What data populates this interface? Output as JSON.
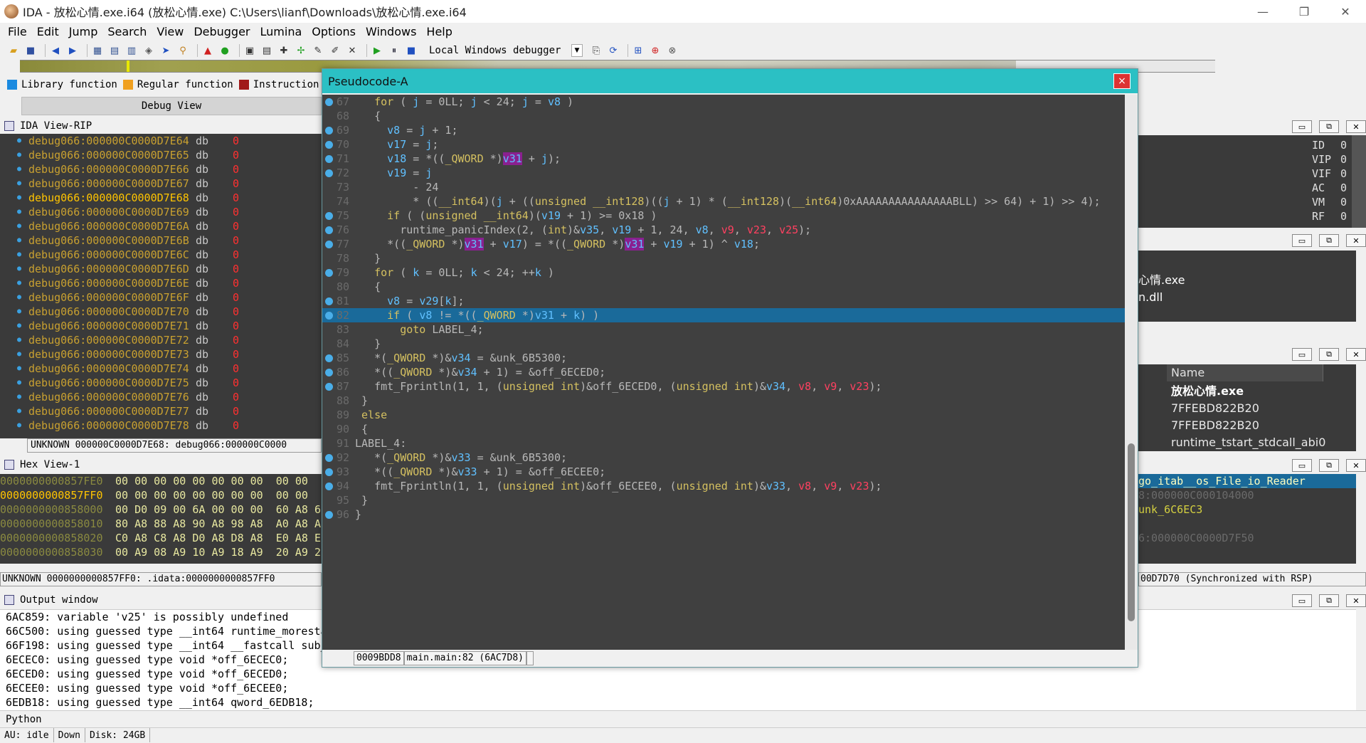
{
  "window": {
    "title": "IDA - 放松心情.exe.i64 (放松心情.exe) C:\\Users\\lianf\\Downloads\\放松心情.exe.i64",
    "min": "—",
    "max": "❐",
    "close": "✕"
  },
  "menu": [
    "File",
    "Edit",
    "Jump",
    "Search",
    "View",
    "Debugger",
    "Lumina",
    "Options",
    "Windows",
    "Help"
  ],
  "toolbar": {
    "debugger": "Local Windows debugger"
  },
  "legend": [
    {
      "label": "Library function",
      "color": "#1a8ae0"
    },
    {
      "label": "Regular function",
      "color": "#f0a020"
    },
    {
      "label": "Instruction",
      "color": "#a01818"
    }
  ],
  "debug_view_tab": "Debug View",
  "ida_view": {
    "title": "IDA View-RIP",
    "rows": [
      {
        "addr": "debug066:000000C0000D7E64",
        "op": "db",
        "val": "0"
      },
      {
        "addr": "debug066:000000C0000D7E65",
        "op": "db",
        "val": "0"
      },
      {
        "addr": "debug066:000000C0000D7E66",
        "op": "db",
        "val": "0"
      },
      {
        "addr": "debug066:000000C0000D7E67",
        "op": "db",
        "val": "0"
      },
      {
        "addr": "debug066:000000C0000D7E68",
        "op": "db",
        "val": "0"
      },
      {
        "addr": "debug066:000000C0000D7E69",
        "op": "db",
        "val": "0"
      },
      {
        "addr": "debug066:000000C0000D7E6A",
        "op": "db",
        "val": "0"
      },
      {
        "addr": "debug066:000000C0000D7E6B",
        "op": "db",
        "val": "0"
      },
      {
        "addr": "debug066:000000C0000D7E6C",
        "op": "db",
        "val": "0"
      },
      {
        "addr": "debug066:000000C0000D7E6D",
        "op": "db",
        "val": "0"
      },
      {
        "addr": "debug066:000000C0000D7E6E",
        "op": "db",
        "val": "0"
      },
      {
        "addr": "debug066:000000C0000D7E6F",
        "op": "db",
        "val": "0"
      },
      {
        "addr": "debug066:000000C0000D7E70",
        "op": "db",
        "val": "0"
      },
      {
        "addr": "debug066:000000C0000D7E71",
        "op": "db",
        "val": "0"
      },
      {
        "addr": "debug066:000000C0000D7E72",
        "op": "db",
        "val": "0"
      },
      {
        "addr": "debug066:000000C0000D7E73",
        "op": "db",
        "val": "0"
      },
      {
        "addr": "debug066:000000C0000D7E74",
        "op": "db",
        "val": "0"
      },
      {
        "addr": "debug066:000000C0000D7E75",
        "op": "db",
        "val": "0"
      },
      {
        "addr": "debug066:000000C0000D7E76",
        "op": "db",
        "val": "0"
      },
      {
        "addr": "debug066:000000C0000D7E77",
        "op": "db",
        "val": "0"
      },
      {
        "addr": "debug066:000000C0000D7E78",
        "op": "db",
        "val": "0"
      }
    ],
    "status": "UNKNOWN 000000C0000D7E68: debug066:000000C0000"
  },
  "hex_view": {
    "title": "Hex View-1",
    "rows": [
      {
        "addr": "0000000000857FE0",
        "bytes": "00 00 00 00 00 00 00 00  00 00"
      },
      {
        "addr": "0000000000857FF0",
        "bytes": "00 00 00 00 00 00 00 00  00 00"
      },
      {
        "addr": "0000000000858000",
        "bytes": "00 D0 09 00 6A 00 00 00  60 A8 6"
      },
      {
        "addr": "0000000000858010",
        "bytes": "80 A8 88 A8 90 A8 98 A8  A0 A8 A"
      },
      {
        "addr": "0000000000858020",
        "bytes": "C0 A8 C8 A8 D0 A8 D8 A8  E0 A8 E"
      },
      {
        "addr": "0000000000858030",
        "bytes": "00 A9 08 A9 10 A9 18 A9  20 A9 2"
      }
    ],
    "status": "UNKNOWN 0000000000857FF0: .idata:0000000000857FF0"
  },
  "output": {
    "title": "Output window",
    "lines": [
      "6AC859: variable 'v25' is possibly undefined",
      "66C500: using guessed type __int64 runtime_moresta",
      "66F198: using guessed type __int64 __fastcall sub_",
      "6ECEC0: using guessed type void *off_6ECEC0;",
      "6ECED0: using guessed type void *off_6ECED0;",
      "6ECEE0: using guessed type void *off_6ECEE0;",
      "6EDB18: using guessed type __int64 qword_6EDB18;"
    ],
    "python": "Python"
  },
  "statusbar": {
    "au": "AU:  idle",
    "dir": "Down",
    "disk": "Disk: 24GB"
  },
  "registers": [
    {
      "name": "ID",
      "val": "0"
    },
    {
      "name": "VIP",
      "val": "0"
    },
    {
      "name": "VIF",
      "val": "0"
    },
    {
      "name": "AC",
      "val": "0"
    },
    {
      "name": "VM",
      "val": "0"
    },
    {
      "name": "RF",
      "val": "0"
    }
  ],
  "modules": [
    "心情.exe",
    "n.dll"
  ],
  "threads": {
    "col_name": "Name",
    "rows": [
      "放松心情.exe",
      "7FFEBD822B20",
      "7FFEBD822B20",
      "runtime_tstart_stdcall_abi0"
    ]
  },
  "stack": {
    "rows": [
      {
        "text": "go_itab__os_File_io_Reader",
        "sel": true
      },
      {
        "text": "8:000000C000104000",
        "sel": false
      },
      {
        "text": "unk_6C6EC3",
        "sel": false
      },
      {
        "text": "",
        "sel": false
      },
      {
        "text": "6:000000C0000D7F50",
        "sel": false
      }
    ],
    "status": "00D7D70 (Synchronized with RSP)"
  },
  "pseudocode": {
    "title": "Pseudocode-A",
    "close": "×",
    "status_addr": "0009BDD8",
    "status_func": "main.main:82 (6AC7D8)"
  }
}
